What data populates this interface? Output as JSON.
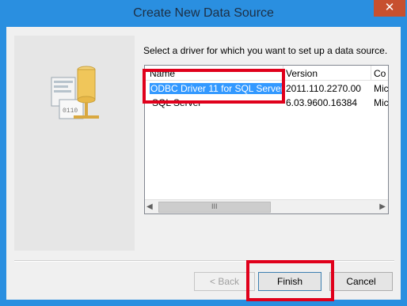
{
  "window": {
    "title": "Create New Data Source",
    "close_label": "✕"
  },
  "instruction": "Select a driver for which you want to set up a data source.",
  "columns": [
    "Name",
    "Version",
    "Co"
  ],
  "drivers": [
    {
      "name": "ODBC Driver 11 for SQL Server",
      "version": "2011.110.2270.00",
      "company": "Mic"
    },
    {
      "name": "SQL Server",
      "version": "6.03.9600.16384",
      "company": "Mic"
    }
  ],
  "scrollbar": {
    "grip": "III"
  },
  "buttons": {
    "back": "< Back",
    "finish": "Finish",
    "cancel": "Cancel"
  },
  "icons": {
    "wizard": "database-driver-icon"
  },
  "colors": {
    "titlebar": "#2a8fe0",
    "selection": "#3399ff",
    "highlight": "#e0001b"
  }
}
